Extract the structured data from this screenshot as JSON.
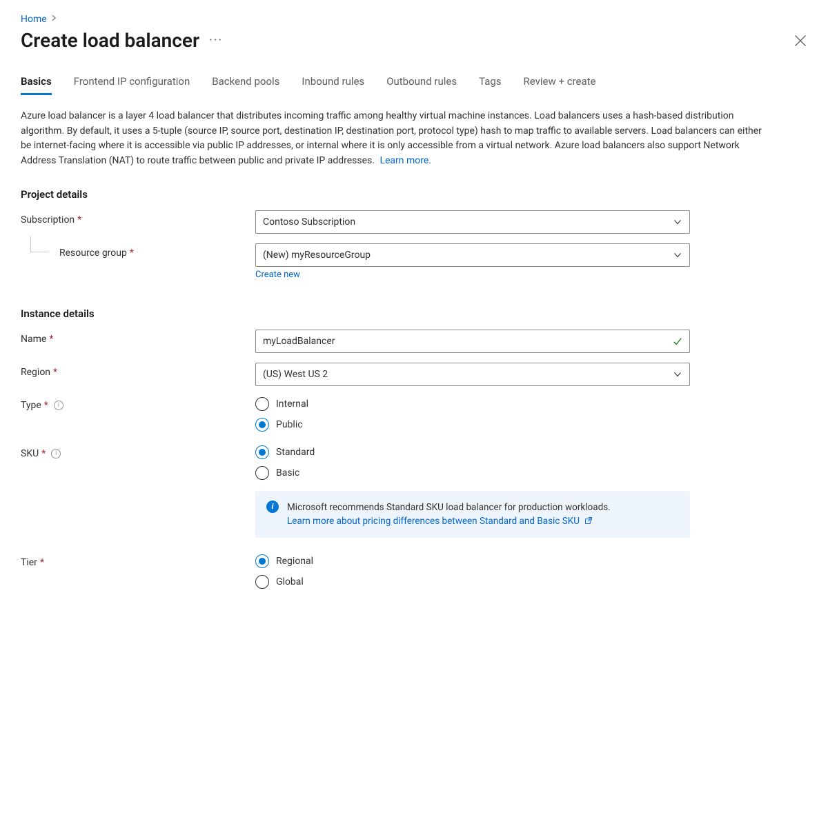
{
  "breadcrumb": {
    "home": "Home"
  },
  "title": "Create load balancer",
  "tabs": [
    {
      "label": "Basics",
      "active": true
    },
    {
      "label": "Frontend IP configuration",
      "active": false
    },
    {
      "label": "Backend pools",
      "active": false
    },
    {
      "label": "Inbound rules",
      "active": false
    },
    {
      "label": "Outbound rules",
      "active": false
    },
    {
      "label": "Tags",
      "active": false
    },
    {
      "label": "Review + create",
      "active": false
    }
  ],
  "description": {
    "body": "Azure load balancer is a layer 4 load balancer that distributes incoming traffic among healthy virtual machine instances. Load balancers uses a hash-based distribution algorithm. By default, it uses a 5-tuple (source IP, source port, destination IP, destination port, protocol type) hash to map traffic to available servers. Load balancers can either be internet-facing where it is accessible via public IP addresses, or internal where it is only accessible from a virtual network. Azure load balancers also support Network Address Translation (NAT) to route traffic between public and private IP addresses.",
    "learn_more": "Learn more."
  },
  "sections": {
    "project_heading": "Project details",
    "instance_heading": "Instance details"
  },
  "fields": {
    "subscription": {
      "label": "Subscription",
      "value": "Contoso Subscription"
    },
    "resource_group": {
      "label": "Resource group",
      "value": "(New) myResourceGroup",
      "create_new": "Create new"
    },
    "name": {
      "label": "Name",
      "value": "myLoadBalancer"
    },
    "region": {
      "label": "Region",
      "value": "(US) West US 2"
    },
    "type": {
      "label": "Type",
      "options": [
        {
          "label": "Internal",
          "selected": false
        },
        {
          "label": "Public",
          "selected": true
        }
      ]
    },
    "sku": {
      "label": "SKU",
      "options": [
        {
          "label": "Standard",
          "selected": true
        },
        {
          "label": "Basic",
          "selected": false
        }
      ],
      "info_text": "Microsoft recommends Standard SKU load balancer for production workloads.",
      "info_link": "Learn more about pricing differences between Standard and Basic SKU"
    },
    "tier": {
      "label": "Tier",
      "options": [
        {
          "label": "Regional",
          "selected": true
        },
        {
          "label": "Global",
          "selected": false
        }
      ]
    }
  }
}
